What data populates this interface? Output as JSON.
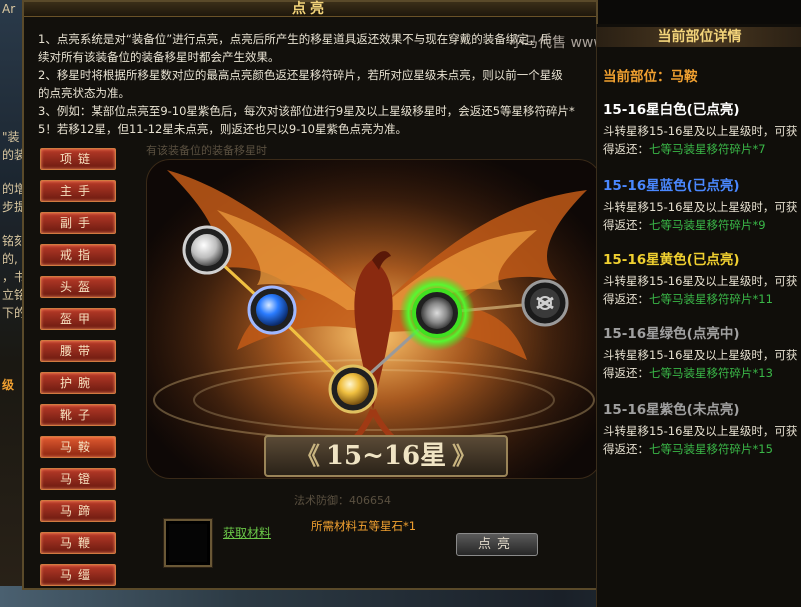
{
  "window": {
    "title": "点亮",
    "description": [
      "1、点亮系统是对“装备位”进行点亮，点亮后所产生的移星道具返还效果不与现在穿戴的装备绑定，后",
      "续对所有该装备位的装备移星时都会产生效果。",
      "2、移星时将根据所移星数对应的最高点亮颜色返还星移符碎片，若所对应星级未点亮，则以前一个星级",
      "的点亮状态为准。",
      "3、例如：某部位点亮至9-10星紫色后，每次对该部位进行9星及以上星级移星时，会返还5等星移符碎片*",
      "5！若移12星，但11-12星未点亮，则返还也只以9-10星紫色点亮为准。"
    ]
  },
  "slots": [
    {
      "label": "项链",
      "active": false
    },
    {
      "label": "主手",
      "active": false
    },
    {
      "label": "副手",
      "active": false
    },
    {
      "label": "戒指",
      "active": false
    },
    {
      "label": "头盔",
      "active": false
    },
    {
      "label": "盔甲",
      "active": false
    },
    {
      "label": "腰带",
      "active": false
    },
    {
      "label": "护腕",
      "active": false
    },
    {
      "label": "靴子",
      "active": false
    },
    {
      "label": "马鞍",
      "active": true
    },
    {
      "label": "马镫",
      "active": false
    },
    {
      "label": "马蹄",
      "active": false
    },
    {
      "label": "马鞭",
      "active": false
    },
    {
      "label": "马缰",
      "active": false
    }
  ],
  "scene": {
    "banner": "15~16星",
    "banner_left": "《",
    "banner_right": "》",
    "ghost_top": "有该装备位的装备移星时",
    "ghost_bottom": "法术防御：406654",
    "nodes": [
      {
        "name": "white",
        "color": "#e8e8e8",
        "state": "lit"
      },
      {
        "name": "blue",
        "color": "#2a7cff",
        "state": "lit"
      },
      {
        "name": "yellow",
        "color": "#f0c040",
        "state": "lit"
      },
      {
        "name": "green",
        "color": "#40e020",
        "state": "lighting"
      },
      {
        "name": "purple",
        "color": "#8a8a8a",
        "state": "locked"
      }
    ]
  },
  "material": {
    "link": "获取材料",
    "need": "所需材料五等星石*1",
    "button": "点亮"
  },
  "side": {
    "header": "当前部位详情",
    "watermark": "小马代售 www.xxds",
    "current_part": "当前部位：马鞍",
    "tiers": [
      {
        "title": "15-16星白色(已点亮)",
        "color": "#ffffff",
        "line1": "斗转星移15-16星及以上星级时，可获",
        "line2_prefix": "得返还：",
        "line2_reward": "七等马装星移符碎片*7"
      },
      {
        "title": "15-16星蓝色(已点亮)",
        "color": "#4a88ff",
        "line1": "斗转星移15-16星及以上星级时，可获",
        "line2_prefix": "得返还：",
        "line2_reward": "七等马装星移符碎片*9"
      },
      {
        "title": "15-16星黄色(已点亮)",
        "color": "#f0d030",
        "line1": "斗转星移15-16星及以上星级时，可获",
        "line2_prefix": "得返还：",
        "line2_reward": "七等马装星移符碎片*11"
      },
      {
        "title": "15-16星绿色(点亮中)",
        "color": "#a0a0a0",
        "line1": "斗转星移15-16星及以上星级时，可获",
        "line2_prefix": "得返还：",
        "line2_reward": "七等马装星移符碎片*13"
      },
      {
        "title": "15-16星紫色(未点亮)",
        "color": "#a0a0a0",
        "line1": "斗转星移15-16星及以上星级时，可获",
        "line2_prefix": "得返还：",
        "line2_reward": "七等马装星移符碎片*15"
      }
    ]
  },
  "background": {
    "fragments": [
      "Ar",
      "\"装",
      "的装",
      "的增",
      "步提",
      "铭刻",
      "的,",
      "，书",
      "立铭",
      "下的",
      "级"
    ]
  }
}
